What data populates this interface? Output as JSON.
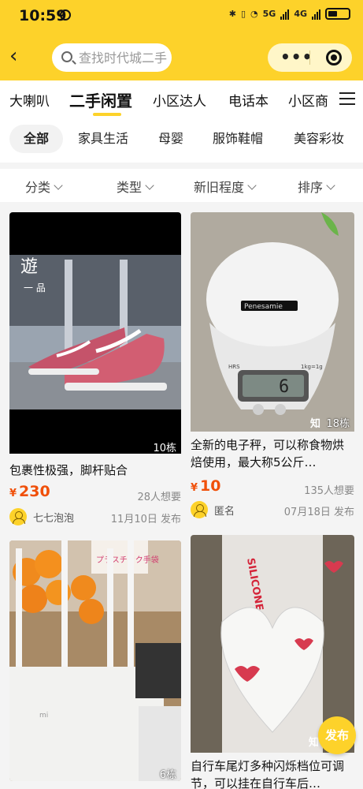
{
  "status_bar": {
    "time": "10:59",
    "network_5g": "5G",
    "network_4g": "4G"
  },
  "header": {
    "search_placeholder": "查找时代城二手",
    "more_label": "•••"
  },
  "tabs": [
    "大喇叭",
    "二手闲置",
    "小区达人",
    "电话本",
    "小区商"
  ],
  "active_tab": "二手闲置",
  "chips": [
    "全部",
    "家具生活",
    "母婴",
    "服饰鞋帽",
    "美容彩妆"
  ],
  "filters": [
    "分类",
    "类型",
    "新旧程度",
    "排序"
  ],
  "listings": [
    {
      "title": "包裹性极强，脚杆贴合",
      "price": "230",
      "currency": "¥",
      "wants": "28人想要",
      "seller": "七七泡泡",
      "date": "11月10日 发布",
      "building": "10栋",
      "image_overlay": "遊",
      "image_caption": "一 品"
    },
    {
      "title": "全新的电子秤，可以称食物烘焙使用，最大称5公斤…",
      "price": "10",
      "currency": "¥",
      "wants": "135人想要",
      "seller": "匿名",
      "date": "07月18日 发布",
      "building": "18栋",
      "watermark": "知",
      "battery_label": "Penesamie",
      "scale_display": "6",
      "scale_label_left": "HRS",
      "scale_label_right": "1kg=1g"
    },
    {
      "title": "",
      "building": "6栋",
      "bag_label": "プラスチック手袋",
      "router_logo": "mi"
    },
    {
      "title": "自行车尾灯多种闪烁档位可调节，可以挂在自行车后…",
      "watermark": "知",
      "package_text": "SILICONE LIGHT"
    }
  ],
  "fab_label": "发布",
  "colors": {
    "brand": "#fdd22a",
    "price": "#f0500a"
  }
}
